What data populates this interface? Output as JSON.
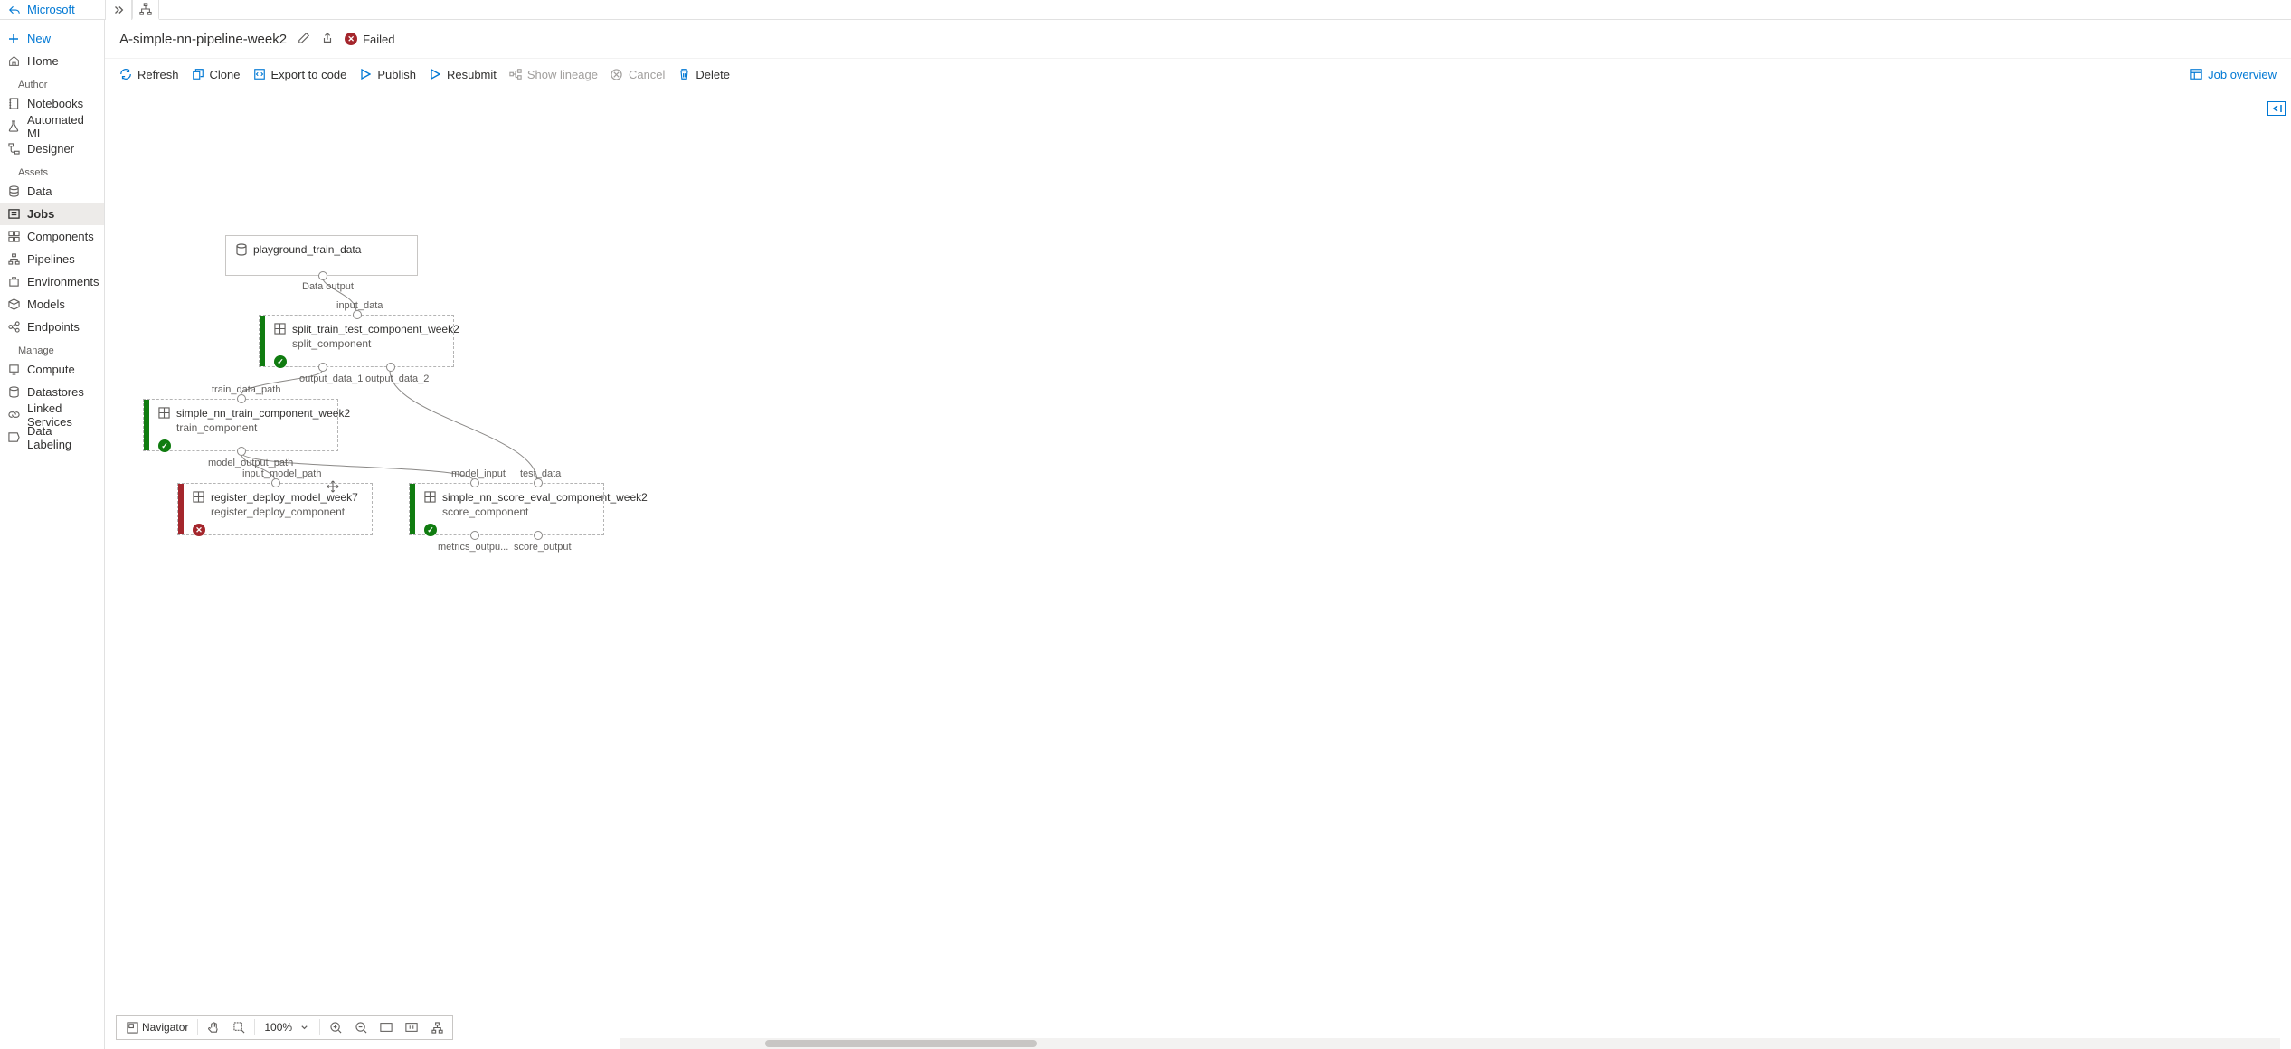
{
  "topStrip": {
    "backLabel": "Microsoft"
  },
  "sidebar": {
    "new": "New",
    "home": "Home",
    "sections": {
      "author": {
        "label": "Author",
        "items": [
          {
            "key": "notebooks",
            "label": "Notebooks"
          },
          {
            "key": "automl",
            "label": "Automated ML"
          },
          {
            "key": "designer",
            "label": "Designer"
          }
        ]
      },
      "assets": {
        "label": "Assets",
        "items": [
          {
            "key": "data",
            "label": "Data"
          },
          {
            "key": "jobs",
            "label": "Jobs",
            "active": true
          },
          {
            "key": "components",
            "label": "Components"
          },
          {
            "key": "pipelines",
            "label": "Pipelines"
          },
          {
            "key": "environments",
            "label": "Environments"
          },
          {
            "key": "models",
            "label": "Models"
          },
          {
            "key": "endpoints",
            "label": "Endpoints"
          }
        ]
      },
      "manage": {
        "label": "Manage",
        "items": [
          {
            "key": "compute",
            "label": "Compute"
          },
          {
            "key": "datastores",
            "label": "Datastores"
          },
          {
            "key": "linked",
            "label": "Linked Services"
          },
          {
            "key": "labeling",
            "label": "Data Labeling"
          }
        ]
      }
    }
  },
  "titleBar": {
    "title": "A-simple-nn-pipeline-week2",
    "status": "Failed"
  },
  "toolbar": {
    "refresh": "Refresh",
    "clone": "Clone",
    "exportCode": "Export to code",
    "publish": "Publish",
    "resubmit": "Resubmit",
    "showLineage": "Show lineage",
    "cancel": "Cancel",
    "delete": "Delete",
    "jobOverview": "Job overview"
  },
  "bottomBar": {
    "navigator": "Navigator",
    "zoom": "100%"
  },
  "graph": {
    "nodes": {
      "data": {
        "title": "playground_train_data",
        "outPort": "Data output"
      },
      "split": {
        "title": "split_train_test_component_week2",
        "subtitle": "split_component",
        "inPort": "input_data",
        "outPort1": "output_data_1",
        "outPort2": "output_data_2"
      },
      "train": {
        "title": "simple_nn_train_component_week2",
        "subtitle": "train_component",
        "inPort": "train_data_path",
        "outPort": "model_output_path"
      },
      "register": {
        "title": "register_deploy_model_week7",
        "subtitle": "register_deploy_component",
        "inPort": "input_model_path"
      },
      "score": {
        "title": "simple_nn_score_eval_component_week2",
        "subtitle": "score_component",
        "inPort1": "model_input",
        "inPort2": "test_data",
        "outPort1": "metrics_outpu...",
        "outPort2": "score_output"
      }
    }
  }
}
